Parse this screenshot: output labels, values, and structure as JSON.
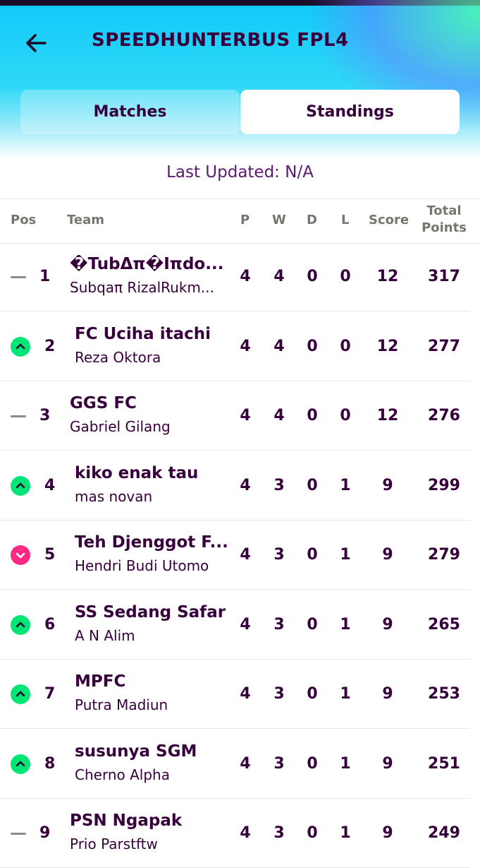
{
  "header": {
    "title": "SPEEDHUNTERBUS FPL4",
    "tabs": [
      {
        "label": "Matches",
        "active": false
      },
      {
        "label": "Standings",
        "active": true
      }
    ]
  },
  "last_updated": "Last Updated: N/A",
  "table": {
    "columns": [
      "Pos",
      "Team",
      "P",
      "W",
      "D",
      "L",
      "Score",
      "Total",
      "Points"
    ],
    "rows": [
      {
        "pos": "1",
        "movement": "same",
        "team": "�TubΔπ�Iπdo...",
        "manager": "Subqaπ RizalRukm...",
        "p": "4",
        "w": "4",
        "d": "0",
        "l": "0",
        "score": "12",
        "total": "317"
      },
      {
        "pos": "2",
        "movement": "up",
        "team": "FC Uciha itachi",
        "manager": "Reza Oktora",
        "p": "4",
        "w": "4",
        "d": "0",
        "l": "0",
        "score": "12",
        "total": "277"
      },
      {
        "pos": "3",
        "movement": "same",
        "team": "GGS FC",
        "manager": "Gabriel Gilang",
        "p": "4",
        "w": "4",
        "d": "0",
        "l": "0",
        "score": "12",
        "total": "276"
      },
      {
        "pos": "4",
        "movement": "up",
        "team": "kiko enak tau",
        "manager": "mas novan",
        "p": "4",
        "w": "3",
        "d": "0",
        "l": "1",
        "score": "9",
        "total": "299"
      },
      {
        "pos": "5",
        "movement": "down",
        "team": "Teh Djenggot F...",
        "manager": "Hendri Budi Utomo",
        "p": "4",
        "w": "3",
        "d": "0",
        "l": "1",
        "score": "9",
        "total": "279"
      },
      {
        "pos": "6",
        "movement": "up",
        "team": "SS Sedang Safar",
        "manager": "A N Alim",
        "p": "4",
        "w": "3",
        "d": "0",
        "l": "1",
        "score": "9",
        "total": "265"
      },
      {
        "pos": "7",
        "movement": "up",
        "team": "MPFC",
        "manager": "Putra Madiun",
        "p": "4",
        "w": "3",
        "d": "0",
        "l": "1",
        "score": "9",
        "total": "253"
      },
      {
        "pos": "8",
        "movement": "up",
        "team": "susunya SGM",
        "manager": "Cherno Alpha",
        "p": "4",
        "w": "3",
        "d": "0",
        "l": "1",
        "score": "9",
        "total": "251"
      },
      {
        "pos": "9",
        "movement": "same",
        "team": "PSN Ngapak",
        "manager": "Prio Parstftw",
        "p": "4",
        "w": "3",
        "d": "0",
        "l": "1",
        "score": "9",
        "total": "249"
      }
    ]
  },
  "colors": {
    "text": "#37003c",
    "up": "#00e676",
    "down": "#ff2882",
    "same": "#8a8a8a"
  }
}
